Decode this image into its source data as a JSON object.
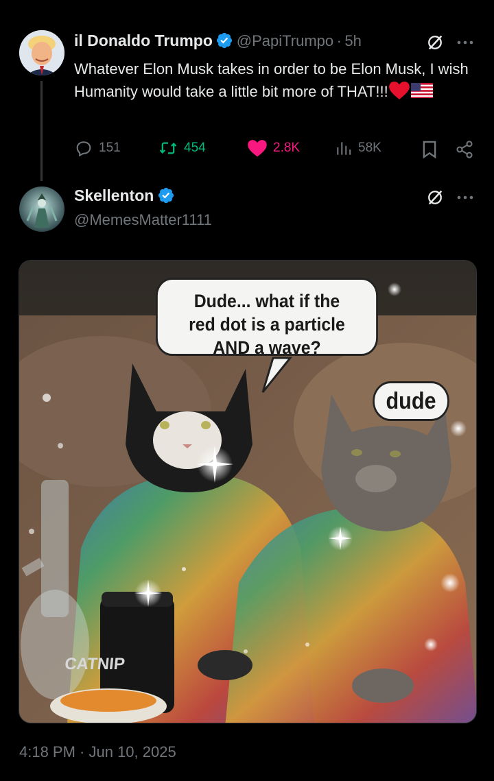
{
  "post": {
    "author_name": "il Donaldo Trumpo",
    "handle": "@PapiTrumpo",
    "separator": "·",
    "time": "5h",
    "text": "Whatever Elon Musk takes in order to be Elon Musk, I wish Humanity would take a little bit more of THAT!!!",
    "actions": {
      "replies": "151",
      "reposts": "454",
      "likes": "2.8K",
      "views": "58K"
    }
  },
  "reply": {
    "author_name": "Skellenton",
    "handle": "@MemesMatter1111",
    "meme": {
      "bubble_1": "Dude... what if the red dot is a particle AND a wave?",
      "bubble_2": "dude",
      "jar_label": "CATNIP"
    },
    "timestamp": "4:18 PM · Jun 10, 2025"
  },
  "colors": {
    "background": "#000000",
    "text": "#e7e9ea",
    "muted": "#71767b",
    "verified": "#1d9bf0",
    "repost": "#00ba7c",
    "like": "#f91880"
  },
  "icons": [
    "verified-badge-icon",
    "grok-icon",
    "more-icon",
    "reply-icon",
    "repost-icon",
    "like-icon",
    "views-icon",
    "bookmark-icon",
    "share-icon",
    "heart-emoji-icon",
    "us-flag-emoji-icon"
  ]
}
